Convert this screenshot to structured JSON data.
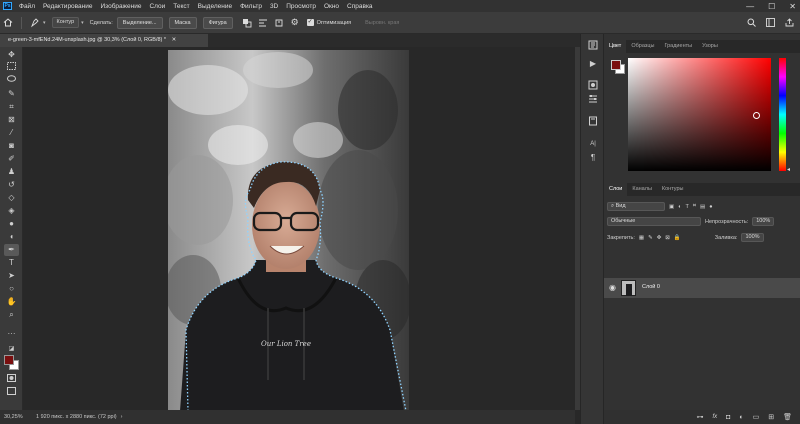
{
  "app": {
    "logo_text": "Ps"
  },
  "menu": [
    "Файл",
    "Редактирование",
    "Изображение",
    "Слои",
    "Текст",
    "Выделение",
    "Фильтр",
    "3D",
    "Просмотр",
    "Окно",
    "Справка"
  ],
  "window_controls": {
    "minimize": "—",
    "maximize": "☐",
    "close": "✕"
  },
  "options_bar": {
    "mode_select": "Контур",
    "make_label": "Сделать:",
    "selection_button": "Выделение...",
    "mask_button": "Маска",
    "shape_button": "Фигура",
    "optimization_label": "Оптимизация",
    "align_edges_label": "Выровн. края"
  },
  "document_tab": {
    "title": "e-green-3-mfENd.24M-unsplash.jpg @ 30,3% (Слой 0, RGB/8) *",
    "close": "✕"
  },
  "status": {
    "zoom": "30,25%",
    "doc_info": "1 920 пикс. x 2880 пикс. (72 ppi)",
    "arrow": "›"
  },
  "color_panel": {
    "tabs": [
      "Цвет",
      "Образцы",
      "Градиенты",
      "Узоры"
    ],
    "foreground": "#7a0f0f",
    "background": "#ffffff",
    "hue": "#ff0000"
  },
  "layers_panel": {
    "tabs": [
      "Слои",
      "Каналы",
      "Контуры"
    ],
    "filter_label": "Вид",
    "blend_mode": "Обычные",
    "opacity_label": "Непрозрачность:",
    "opacity_value": "100%",
    "lock_label": "Закрепить:",
    "fill_label": "Заливка:",
    "fill_value": "100%",
    "layers": [
      {
        "name": "Слой 0",
        "visible": true
      }
    ]
  },
  "photo": {
    "colors": {
      "bg_light": "#bcbcbc",
      "bg_dark": "#3c3c3c",
      "hoodie": "#1d1d1f",
      "skin": "#c69a86",
      "hair": "#3a2a22",
      "selection": "#8fd3ff"
    },
    "hoodie_text": "Our Lion Tree"
  }
}
